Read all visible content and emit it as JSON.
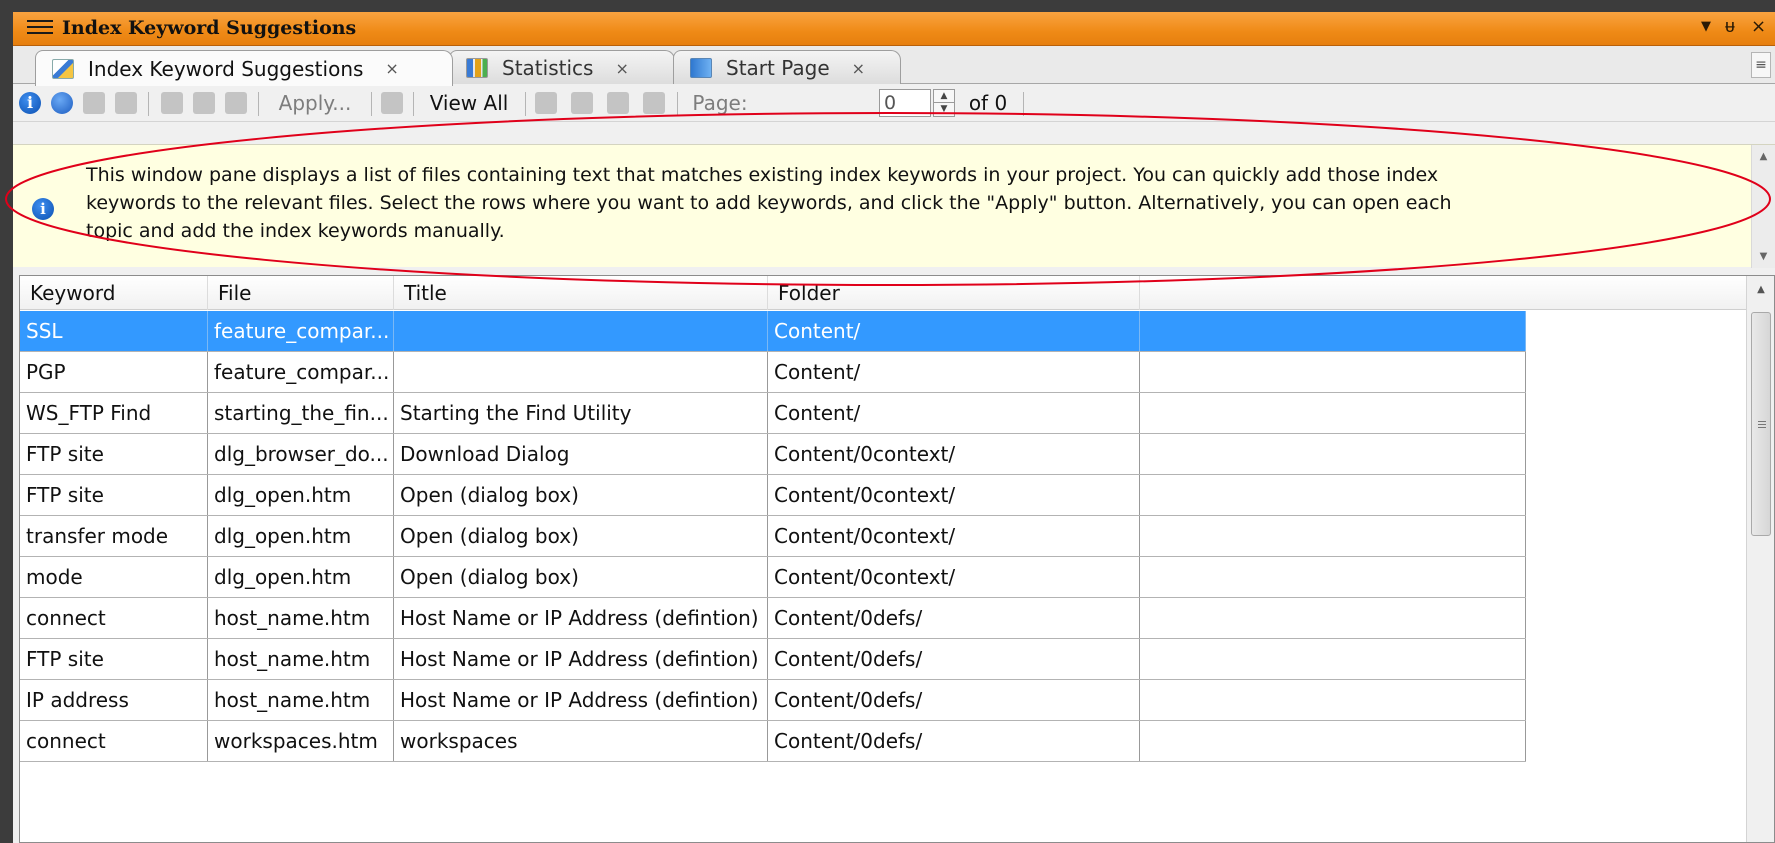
{
  "window": {
    "title": "Index Keyword Suggestions",
    "dropdown_glyph": "▼",
    "pin_glyph": "ᵾ",
    "close_glyph": "×"
  },
  "tabs": [
    {
      "label": "Index Keyword Suggestions",
      "icon": "keyword-document-icon",
      "active": true,
      "close": "×"
    },
    {
      "label": "Statistics",
      "icon": "bar-chart-icon",
      "active": false,
      "close": "×"
    },
    {
      "label": "Start Page",
      "icon": "start-page-icon",
      "active": false,
      "close": "×"
    }
  ],
  "toolbar": {
    "apply_label": "Apply...",
    "view_all_label": "View All",
    "page_label": "Page:",
    "page_value": "0",
    "of_label": "of 0"
  },
  "info": {
    "icon": "info-icon",
    "message": "This window pane displays a list of files containing text that matches existing index keywords in your project. You can quickly add those index keywords to the relevant files. Select the rows where you want to add keywords, and click the \"Apply\" button. Alternatively, you can open each topic and add the index keywords manually."
  },
  "grid": {
    "columns": [
      "Keyword",
      "File",
      "Title",
      "Folder",
      ""
    ],
    "rows": [
      {
        "keyword": "SSL",
        "file": "feature_compar...",
        "title": "",
        "folder": "Content/",
        "selected": true
      },
      {
        "keyword": "PGP",
        "file": "feature_compar...",
        "title": "",
        "folder": "Content/",
        "selected": false
      },
      {
        "keyword": "WS_FTP Find",
        "file": "starting_the_fin...",
        "title": "Starting the Find Utility",
        "folder": "Content/",
        "selected": false
      },
      {
        "keyword": "FTP site",
        "file": "dlg_browser_do...",
        "title": "Download Dialog",
        "folder": "Content/0context/",
        "selected": false
      },
      {
        "keyword": "FTP site",
        "file": "dlg_open.htm",
        "title": "Open (dialog box)",
        "folder": "Content/0context/",
        "selected": false
      },
      {
        "keyword": "transfer mode",
        "file": "dlg_open.htm",
        "title": "Open (dialog box)",
        "folder": "Content/0context/",
        "selected": false
      },
      {
        "keyword": "mode",
        "file": "dlg_open.htm",
        "title": "Open (dialog box)",
        "folder": "Content/0context/",
        "selected": false
      },
      {
        "keyword": "connect",
        "file": "host_name.htm",
        "title": "Host Name or IP Address (defintion)",
        "folder": "Content/0defs/",
        "selected": false
      },
      {
        "keyword": "FTP site",
        "file": "host_name.htm",
        "title": "Host Name or IP Address (defintion)",
        "folder": "Content/0defs/",
        "selected": false
      },
      {
        "keyword": "IP address",
        "file": "host_name.htm",
        "title": "Host Name or IP Address (defintion)",
        "folder": "Content/0defs/",
        "selected": false
      },
      {
        "keyword": "connect",
        "file": "workspaces.htm",
        "title": "workspaces",
        "folder": "Content/0defs/",
        "selected": false
      }
    ]
  },
  "colors": {
    "title_bar": "#ef8a16",
    "selection": "#3399ff",
    "info_background": "#ffffe1",
    "annotation": "#e0001a"
  }
}
